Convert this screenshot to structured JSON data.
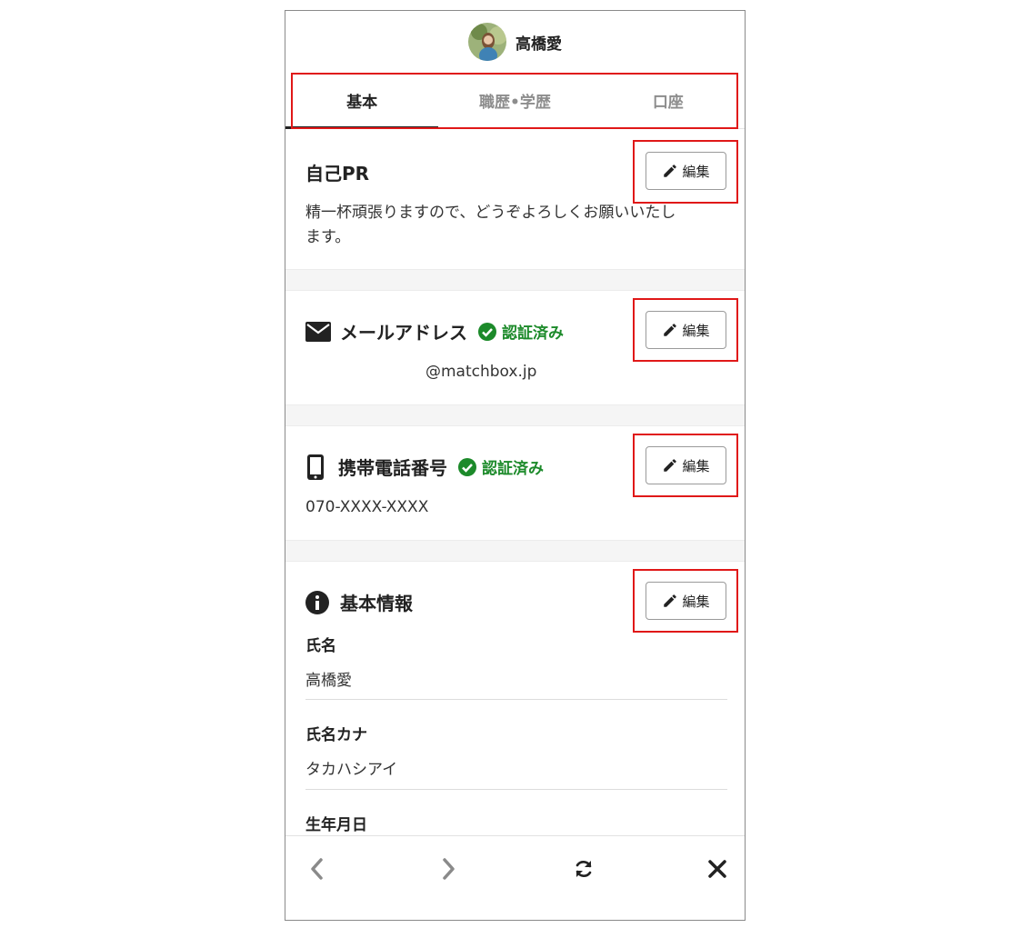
{
  "header": {
    "user_name": "高橋愛",
    "avatar_icon": "avatar-photo"
  },
  "tabs": [
    {
      "label": "基本",
      "active": true
    },
    {
      "label": "職歴•学歴",
      "active": false
    },
    {
      "label": "口座",
      "active": false
    }
  ],
  "edit_label": "編集",
  "self_pr": {
    "title": "自己PR",
    "text_line1": "精一杯頑張りますので、どうぞよろしくお願いいたし",
    "text_line2": "ます。"
  },
  "email": {
    "title": "メールアドレス",
    "icon": "envelope-icon",
    "status": "認証済み",
    "value": "@matchbox.jp"
  },
  "phone": {
    "title": "携帯電話番号",
    "icon": "mobile-phone-icon",
    "status": "認証済み",
    "value": "070-XXXX-XXXX"
  },
  "basic_info": {
    "title": "基本情報",
    "icon": "info-icon",
    "fields": [
      {
        "label": "氏名",
        "value": "高橋愛"
      },
      {
        "label": "氏名カナ",
        "value": "タカハシアイ"
      },
      {
        "label": "生年月日",
        "value": ""
      }
    ]
  },
  "bottom_nav": {
    "icons": [
      "back-arrow-icon",
      "forward-arrow-icon",
      "refresh-icon",
      "close-icon"
    ]
  },
  "colors": {
    "verified": "#1c8a2a",
    "highlight": "#e01818",
    "active_tab": "#222222",
    "inactive_tab": "#8d8d8d"
  }
}
